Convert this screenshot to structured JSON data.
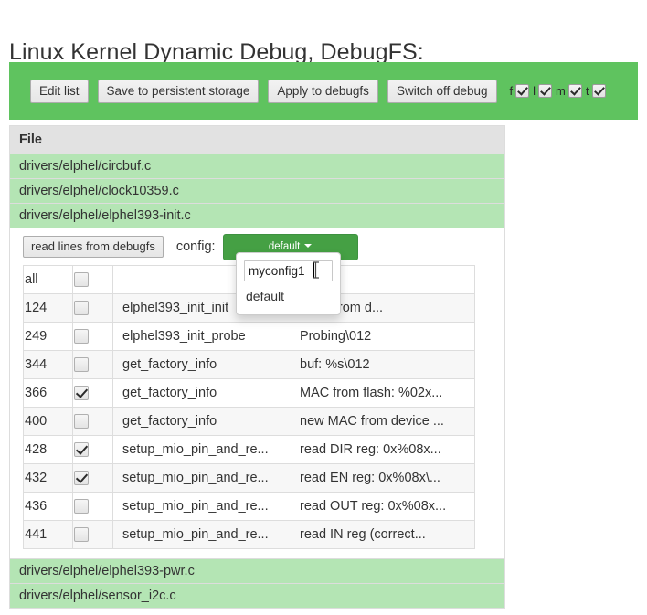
{
  "page_title": "Linux Kernel Dynamic Debug, DebugFS:",
  "toolbar": {
    "buttons": [
      {
        "label": "Edit list",
        "name": "edit-list-button"
      },
      {
        "label": "Save to persistent storage",
        "name": "save-to-persistent-storage-button"
      },
      {
        "label": "Apply to debugfs",
        "name": "apply-to-debugfs-button"
      },
      {
        "label": "Switch off debug",
        "name": "switch-off-debug-button"
      }
    ],
    "flags": [
      {
        "label": "f",
        "checked": true
      },
      {
        "label": "l",
        "checked": true
      },
      {
        "label": "m",
        "checked": true
      },
      {
        "label": "t",
        "checked": true
      }
    ]
  },
  "file_table": {
    "header": "File",
    "files_top": [
      "drivers/elphel/circbuf.c",
      "drivers/elphel/clock10359.c",
      "drivers/elphel/elphel393-init.c"
    ],
    "files_bottom": [
      "drivers/elphel/elphel393-pwr.c",
      "drivers/elphel/sensor_i2c.c"
    ]
  },
  "detail": {
    "read_button": "read lines from debugfs",
    "config_label": "config:",
    "config_button": "default",
    "dropdown": {
      "input_value": "myconfig1",
      "input_placeholder": "",
      "items": [
        "default"
      ]
    },
    "lines_table": {
      "header": {
        "line": "all",
        "check": "",
        "func": "",
        "desc": ""
      },
      "rows": [
        {
          "line": "124",
          "checked": false,
          "func": "elphel393_init_init",
          "desc": "s line from d..."
        },
        {
          "line": "249",
          "checked": false,
          "func": "elphel393_init_probe",
          "desc": "Probing\\012"
        },
        {
          "line": "344",
          "checked": false,
          "func": "get_factory_info",
          "desc": "buf: %s\\012"
        },
        {
          "line": "366",
          "checked": true,
          "func": "get_factory_info",
          "desc": "MAC from flash: %02x..."
        },
        {
          "line": "400",
          "checked": false,
          "func": "get_factory_info",
          "desc": "new MAC from device ..."
        },
        {
          "line": "428",
          "checked": true,
          "func": "setup_mio_pin_and_re...",
          "desc": "read DIR reg: 0x%08x..."
        },
        {
          "line": "432",
          "checked": true,
          "func": "setup_mio_pin_and_re...",
          "desc": "read EN reg: 0x%08x\\..."
        },
        {
          "line": "436",
          "checked": false,
          "func": "setup_mio_pin_and_re...",
          "desc": "read OUT reg: 0x%08x..."
        },
        {
          "line": "441",
          "checked": false,
          "func": "setup_mio_pin_and_re...",
          "desc": "read IN reg (correct..."
        }
      ]
    }
  },
  "colors": {
    "toolbar_green": "#5fc35f",
    "file_row_green": "#b4e5b4",
    "config_button_green": "#45a044",
    "header_gray": "#e2e2e2",
    "row_alt_gray": "#f7f7f7",
    "border_gray": "#dddddd"
  }
}
